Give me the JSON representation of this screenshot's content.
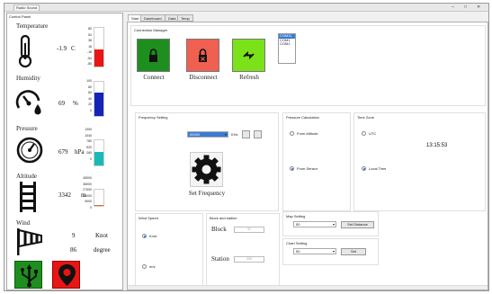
{
  "window": {
    "title": "Radio Sound",
    "controls": [
      "–",
      "□",
      "✕"
    ]
  },
  "left_panel": {
    "title": "Control Panel",
    "temperature": {
      "label": "Temperature",
      "value": "-1.9",
      "unit": "C",
      "scale": [
        "80",
        "54",
        "36",
        "18",
        "-18",
        "-54",
        "-80"
      ],
      "bar_color": "#e81515",
      "bar_level": 0.45
    },
    "humidity": {
      "label": "Humidity",
      "value": "69",
      "unit": "%",
      "scale": [
        "100",
        "80",
        "60",
        "40",
        "20",
        "0"
      ],
      "bar_color": "#1424b8",
      "bar_level": 0.69
    },
    "pressure": {
      "label": "Pressure",
      "value": "679",
      "unit": "hPa",
      "scale": [
        "1300",
        "1040",
        "780",
        "520",
        "260",
        "0"
      ],
      "bar_color": "#1ab9b9",
      "bar_level": 0.52
    },
    "altitude": {
      "label": "Altitude",
      "value": "3342",
      "unit": "m",
      "scale": [
        "45000",
        "36000",
        "27000",
        "18000",
        "9000",
        "0"
      ],
      "bar_color": "#e07020",
      "bar_level": 0.07
    },
    "wind": {
      "label": "Wind",
      "speed_value": "9",
      "speed_unit": "Knot",
      "dir_value": "86",
      "dir_unit": "degree"
    },
    "icons": {
      "usb": "usb-icon",
      "map": "map-pin-icon"
    }
  },
  "tabs": [
    "Start",
    "Dashboard",
    "Data",
    "Temp"
  ],
  "connection": {
    "title": "Connection Manager",
    "connect": "Connect",
    "disconnect": "Disconnect",
    "refresh": "Refresh",
    "ports": [
      "COM11",
      "COM1",
      "COM1"
    ],
    "colors": {
      "connect": "#1e8f1e",
      "disconnect": "#f06050",
      "refresh": "#7be21a"
    }
  },
  "frequency": {
    "title": "Frequency Setting",
    "value": "00000",
    "unit": "KHz",
    "set_label": "Set Frequency"
  },
  "pressure_calc": {
    "title": "Pressure Calculation",
    "from_altitude": "From Altitude",
    "from_sensor": "From Sensor"
  },
  "time_zone": {
    "title": "Time Zone",
    "utc": "UTC",
    "local": "Local Time",
    "time": "13:15:53"
  },
  "wind_speed": {
    "title": "Wind Speed",
    "knot": "Knot",
    "ms": "m/s"
  },
  "block_station": {
    "title": "Block and station",
    "block_label": "Block",
    "block_value": "37",
    "station_label": "Station",
    "station_value": "200"
  },
  "map_setting": {
    "title": "Map Setting",
    "value": "50",
    "button": "Set Distance"
  },
  "chart_setting": {
    "title": "Chart Setting",
    "value": "50",
    "button": "Set"
  }
}
